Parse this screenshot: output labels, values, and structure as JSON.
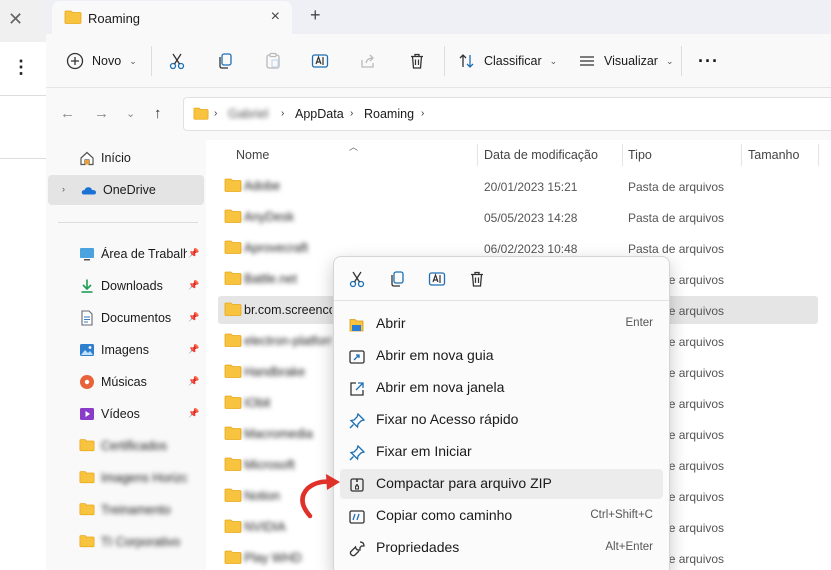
{
  "tab": {
    "title": "Roaming",
    "close": "×",
    "new_tab": "+"
  },
  "toolbar": {
    "new_label": "Novo",
    "sort_label": "Classificar",
    "view_label": "Visualizar",
    "more": "···"
  },
  "address": {
    "crumbs": [
      "Gabriel",
      "AppData",
      "Roaming"
    ],
    "separator": "›"
  },
  "nav": {
    "items": [
      {
        "label": "Início",
        "icon": "home-icon"
      },
      {
        "label": "OneDrive",
        "icon": "onedrive-icon",
        "selected": true
      },
      {
        "label": "Área de Trabalho",
        "icon": "desktop-icon",
        "pinned": true
      },
      {
        "label": "Downloads",
        "icon": "download-icon",
        "pinned": true
      },
      {
        "label": "Documentos",
        "icon": "documents-icon",
        "pinned": true
      },
      {
        "label": "Imagens",
        "icon": "pictures-icon",
        "pinned": true
      },
      {
        "label": "Músicas",
        "icon": "music-icon",
        "pinned": true
      },
      {
        "label": "Vídeos",
        "icon": "videos-icon",
        "pinned": true
      },
      {
        "label": "Certificados",
        "icon": "folder-icon",
        "blurred": true
      },
      {
        "label": "Imagens Horizonte",
        "icon": "folder-icon",
        "blurred": true
      },
      {
        "label": "Treinamento",
        "icon": "folder-icon",
        "blurred": true
      },
      {
        "label": "TI Corporativo",
        "icon": "folder-icon",
        "blurred": true
      }
    ]
  },
  "columns": {
    "name": "Nome",
    "date": "Data de modificação",
    "type": "Tipo",
    "size": "Tamanho"
  },
  "files": [
    {
      "name": "Adobe",
      "date": "20/01/2023 15:21",
      "type": "Pasta de arquivos",
      "blurred": true
    },
    {
      "name": "AnyDesk",
      "date": "05/05/2023 14:28",
      "type": "Pasta de arquivos",
      "blurred": true
    },
    {
      "name": "Aprovecraft",
      "date": "06/02/2023 10:48",
      "type": "Pasta de arquivos",
      "blurred": true
    },
    {
      "name": "Battle.net",
      "date": "",
      "type": "Pasta de arquivos",
      "blurred": true
    },
    {
      "name": "br.com.screenco",
      "date": "",
      "type": "Pasta de arquivos",
      "selected": true
    },
    {
      "name": "electron-platform",
      "date": "",
      "type": "Pasta de arquivos",
      "blurred": true
    },
    {
      "name": "Handbrake",
      "date": "",
      "type": "Pasta de arquivos",
      "blurred": true
    },
    {
      "name": "IObit",
      "date": "",
      "type": "Pasta de arquivos",
      "blurred": true
    },
    {
      "name": "Macromedia",
      "date": "",
      "type": "Pasta de arquivos",
      "blurred": true
    },
    {
      "name": "Microsoft",
      "date": "",
      "type": "Pasta de arquivos",
      "blurred": true
    },
    {
      "name": "Notion",
      "date": "",
      "type": "Pasta de arquivos",
      "blurred": true
    },
    {
      "name": "NVIDIA",
      "date": "",
      "type": "Pasta de arquivos",
      "blurred": true
    },
    {
      "name": "Play WHD",
      "date": "",
      "type": "Pasta de arquivos",
      "blurred": true
    }
  ],
  "context_menu": {
    "items": [
      {
        "label": "Abrir",
        "shortcut": "Enter",
        "icon": "open-folder-icon"
      },
      {
        "label": "Abrir em nova guia",
        "shortcut": "",
        "icon": "new-tab-icon"
      },
      {
        "label": "Abrir em nova janela",
        "shortcut": "",
        "icon": "new-window-icon"
      },
      {
        "label": "Fixar no Acesso rápido",
        "shortcut": "",
        "icon": "pin-icon"
      },
      {
        "label": "Fixar em Iniciar",
        "shortcut": "",
        "icon": "pin-icon"
      },
      {
        "label": "Compactar para arquivo ZIP",
        "shortcut": "",
        "icon": "zip-icon",
        "hover": true
      },
      {
        "label": "Copiar como caminho",
        "shortcut": "Ctrl+Shift+C",
        "icon": "copy-path-icon"
      },
      {
        "label": "Propriedades",
        "shortcut": "Alt+Enter",
        "icon": "properties-icon"
      }
    ]
  },
  "colors": {
    "accent": "#0067c0",
    "folder": "#f8c33f",
    "folder_dark": "#e6a817",
    "annotation_arrow": "#e0302a"
  }
}
